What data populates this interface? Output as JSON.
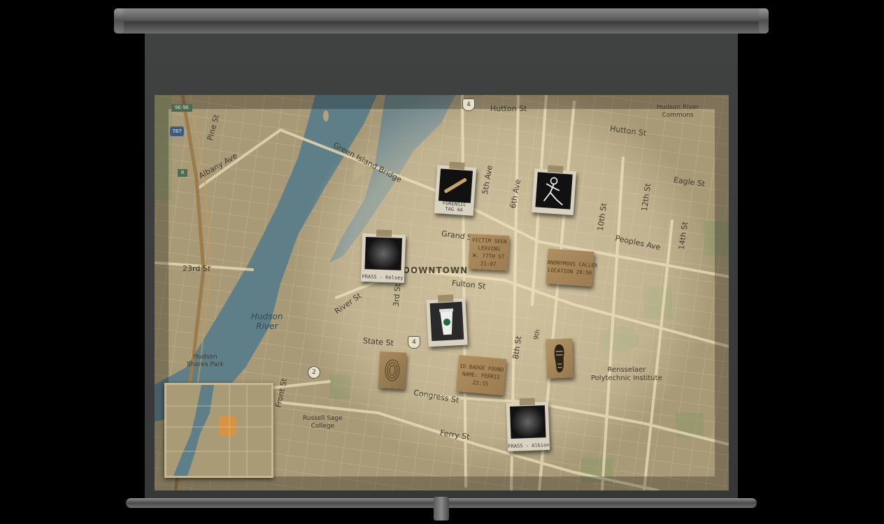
{
  "map": {
    "district": "DOWNTOWN",
    "streets": {
      "hutton_1": "Hutton St",
      "hutton_2": "Hutton St",
      "pine": "Pine St",
      "albany": "Albany Ave",
      "green_island": "Green Island Bridge",
      "fifth_ave": "5th Ave",
      "sixth_ave": "6th Ave",
      "grand": "Grand St",
      "eagle": "Eagle St",
      "twelfth": "12th St",
      "tenth": "10th St",
      "fourteenth": "14th St",
      "peoples": "Peoples Ave",
      "twenty_third": "23rd St",
      "fulton": "Fulton St",
      "river": "River St",
      "third": "3rd St",
      "state": "State St",
      "eighth": "8th St",
      "ninth": "9th",
      "congress": "Congress St",
      "ferry": "Ferry St",
      "front": "Front St"
    },
    "places": {
      "river": "Hudson\nRiver",
      "commons": "Hudson River\nCommons",
      "shores": "Hudson\nShores Park",
      "rpi": "Rensselaer\nPolytechnic Institute",
      "russell": "Russell Sage\nCollege"
    },
    "shields": {
      "route4a": "4",
      "route4b": "4",
      "route2": "2",
      "i787": "787",
      "r9e": "9E-9E",
      "r8": "8"
    }
  },
  "clues": {
    "forensic": {
      "caption": "FORENSIC\nTAG 4A",
      "icon": "bullet-shell-icon"
    },
    "body": {
      "icon": "chalk-outline-icon"
    },
    "kelsey": {
      "caption": "FRASS - Kelsey",
      "icon": "night-photo-icon"
    },
    "victim_note": {
      "text": "VICTIM SEEN\nLEAVING\nW. 77TH ST\n21:07"
    },
    "caller_note": {
      "text": "ANONYMOUS CALLER\nLOCATION 20:50"
    },
    "coffee": {
      "icon": "coffee-cup-icon"
    },
    "fingerprint": {
      "icon": "fingerprint-icon"
    },
    "badge_note": {
      "text": "ID BADGE FOUND\nNAME: FERRIS\n22:15"
    },
    "footprint": {
      "icon": "shoe-print-icon"
    },
    "albion": {
      "caption": "FRASS - Albion",
      "icon": "night-photo-icon"
    }
  },
  "colors": {
    "map_paper": "#b9aa85",
    "water": "#5f7f88",
    "spotlight": "#f4e6c3"
  }
}
